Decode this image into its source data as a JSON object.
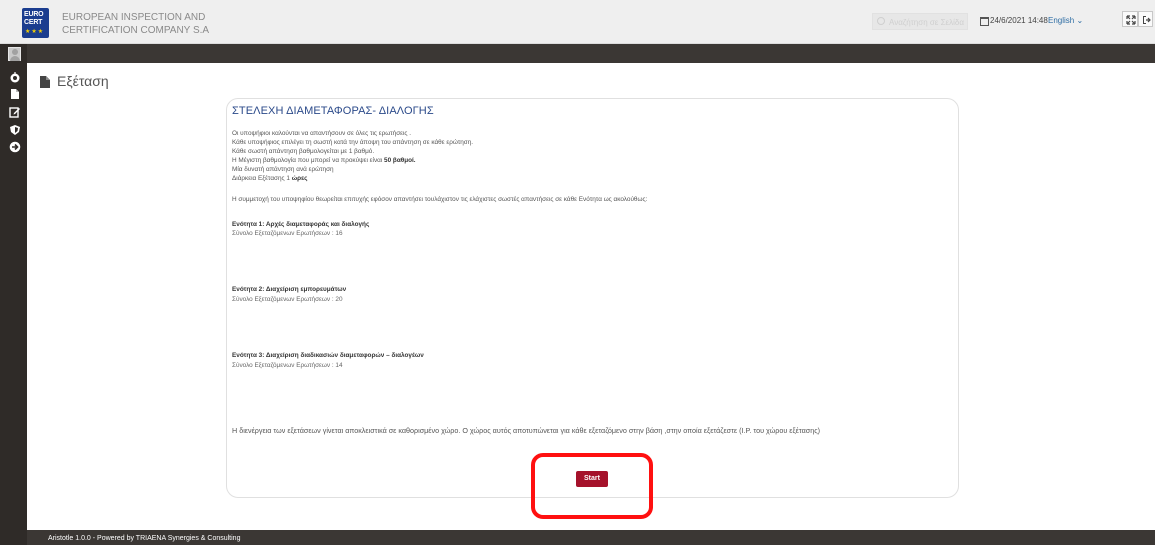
{
  "header": {
    "logo_line1": "EURO",
    "logo_line2": "CERT",
    "company_line1": "EUROPEAN INSPECTION AND",
    "company_line2": "CERTIFICATION COMPANY S.A",
    "search_placeholder": "Αναζήτηση σε Σελίδα",
    "datetime": "24/6/2021 14:48",
    "language": "English",
    "colors": {
      "accent": "#2e6da4",
      "brand": "#1b3d8f"
    },
    "icons": [
      "calendar-icon",
      "expand-icon",
      "logout-icon",
      "search-icon"
    ]
  },
  "sidebar": {
    "icons": [
      "avatar",
      "dashboard-icon",
      "file-icon",
      "edit-icon",
      "shield-icon",
      "arrow-circle-right-icon"
    ]
  },
  "page": {
    "title": "Εξέταση"
  },
  "exam": {
    "title": "ΣΤΕΛΕΧΗ ΔΙΑΜΕΤΑΦΟΡΑΣ- ΔΙΑΛΟΓΗΣ",
    "instructions": [
      "Οι υποψήφιοι καλούνται να απαντήσουν σε όλες τις ερωτήσεις .",
      "Κάθε υποψήφιος επιλέγει τη σωστή κατά την άποψη του απάντηση σε κάθε ερώτηση.",
      "Κάθε σωστή απάντηση βαθμολογείται με 1 βαθμό."
    ],
    "max_score_prefix": "Η Μέγιστη βαθμολογία που μπορεί να προκύψει είναι ",
    "max_score_bold": "50 βαθμοί.",
    "one_answer": "Μία δυνατή απάντηση ανά ερώτηση",
    "duration_prefix": "Διάρκεια Εξέτασης 1 ",
    "duration_bold": "ώρες",
    "pass_rule": "Η συμμετοχή του υποψηφίου θεωρείται επιτυχής εφόσον απαντήσει τουλάχιστον τις ελάχιστες σωστές απαντήσεις σε κάθε Ενότητα ως ακολούθως:",
    "sections": [
      {
        "title": "Ενότητα 1: Αρχές διαμεταφοράς και διαλογής",
        "count": "Σύνολο Εξεταζόμενων Ερωτήσεων : 16"
      },
      {
        "title": "Ενότητα 2: Διαχείριση εμπορευμάτων",
        "count": "Σύνολο Εξεταζόμενων Ερωτήσεων : 20"
      },
      {
        "title": "Ενότητα 3: Διαχείριση διαδικασιών διαμεταφορών – διαλογέων",
        "count": "Σύνολο Εξεταζόμενων Ερωτήσεων : 14"
      }
    ],
    "footnote": "Η διενέργεια των εξετάσεων γίνεται αποκλειστικά σε καθορισμένο χώρο. Ο χώρος αυτός αποτυπώνεται για κάθε εξεταζόμενο στην βάση ,στην οποία εξετάζεστε (Ι.Ρ. του χώρου εξέτασης)",
    "start_label": "Start",
    "start_color": "#a5122b",
    "highlight_color": "#ff1010"
  },
  "footer": {
    "text": "Aristotle 1.0.0 - Powered by TRIAENA Synergies & Consulting"
  }
}
